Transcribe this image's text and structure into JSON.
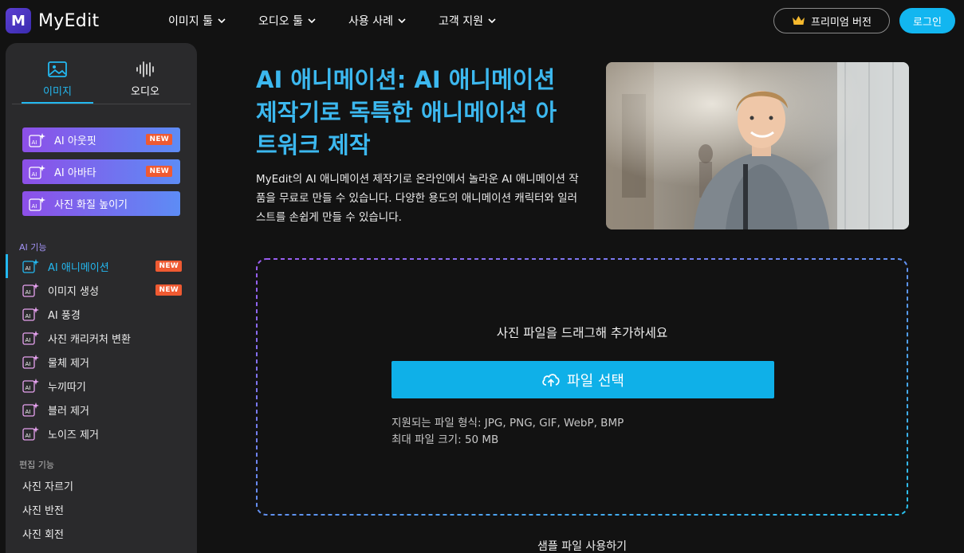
{
  "app": {
    "logo_text": "MyEdit"
  },
  "nav": {
    "items": [
      {
        "label": "이미지 툴"
      },
      {
        "label": "오디오 툴"
      },
      {
        "label": "사용 사례"
      },
      {
        "label": "고객 지원"
      }
    ],
    "premium_label": "프리미엄 버전",
    "login_label": "로그인"
  },
  "sidebar": {
    "tabs": [
      {
        "label": "이미지",
        "active": true
      },
      {
        "label": "오디오",
        "active": false
      }
    ],
    "promos": [
      {
        "label": "AI 아웃핏",
        "badge": "NEW"
      },
      {
        "label": "AI 아바타",
        "badge": "NEW"
      },
      {
        "label": "사진 화질 높이기",
        "badge": ""
      }
    ],
    "ai_section_title": "AI 기능",
    "ai_features": [
      {
        "label": "AI 애니메이션",
        "badge": "NEW",
        "active": true
      },
      {
        "label": "이미지 생성",
        "badge": "NEW",
        "active": false
      },
      {
        "label": "AI 풍경",
        "badge": "",
        "active": false
      },
      {
        "label": "사진 캐리커처 변환",
        "badge": "",
        "active": false
      },
      {
        "label": "물체 제거",
        "badge": "",
        "active": false
      },
      {
        "label": "누끼따기",
        "badge": "",
        "active": false
      },
      {
        "label": "블러 제거",
        "badge": "",
        "active": false
      },
      {
        "label": "노이즈 제거",
        "badge": "",
        "active": false
      }
    ],
    "edit_section_title": "편집 기능",
    "edit_features": [
      {
        "label": "사진 자르기"
      },
      {
        "label": "사진 반전"
      },
      {
        "label": "사진 회전"
      }
    ]
  },
  "hero": {
    "title": "AI 애니메이션: AI 애니메이션 제작기로 독특한 애니메이션 아트워크 제작",
    "description": "MyEdit의 AI 애니메이션 제작기로 온라인에서 놀라운 AI 애니메이션 작품을 무료로 만들 수 있습니다. 다양한 용도의 애니메이션 캐릭터와 일러스트를 손쉽게 만들 수 있습니다."
  },
  "upload": {
    "drop_text": "사진 파일을 드래그해 추가하세요",
    "button_label": "파일 선택",
    "formats_text": "지원되는 파일 형식: JPG, PNG, GIF, WebP, BMP",
    "max_size_text": "최대 파일 크기: 50 MB",
    "sample_link": "샘플 파일 사용하기"
  },
  "colors": {
    "accent": "#12b6f0",
    "badge_new": "#ef5a32",
    "promo_gradient_start": "#8d4fe8",
    "promo_gradient_end": "#5d8cf5"
  }
}
